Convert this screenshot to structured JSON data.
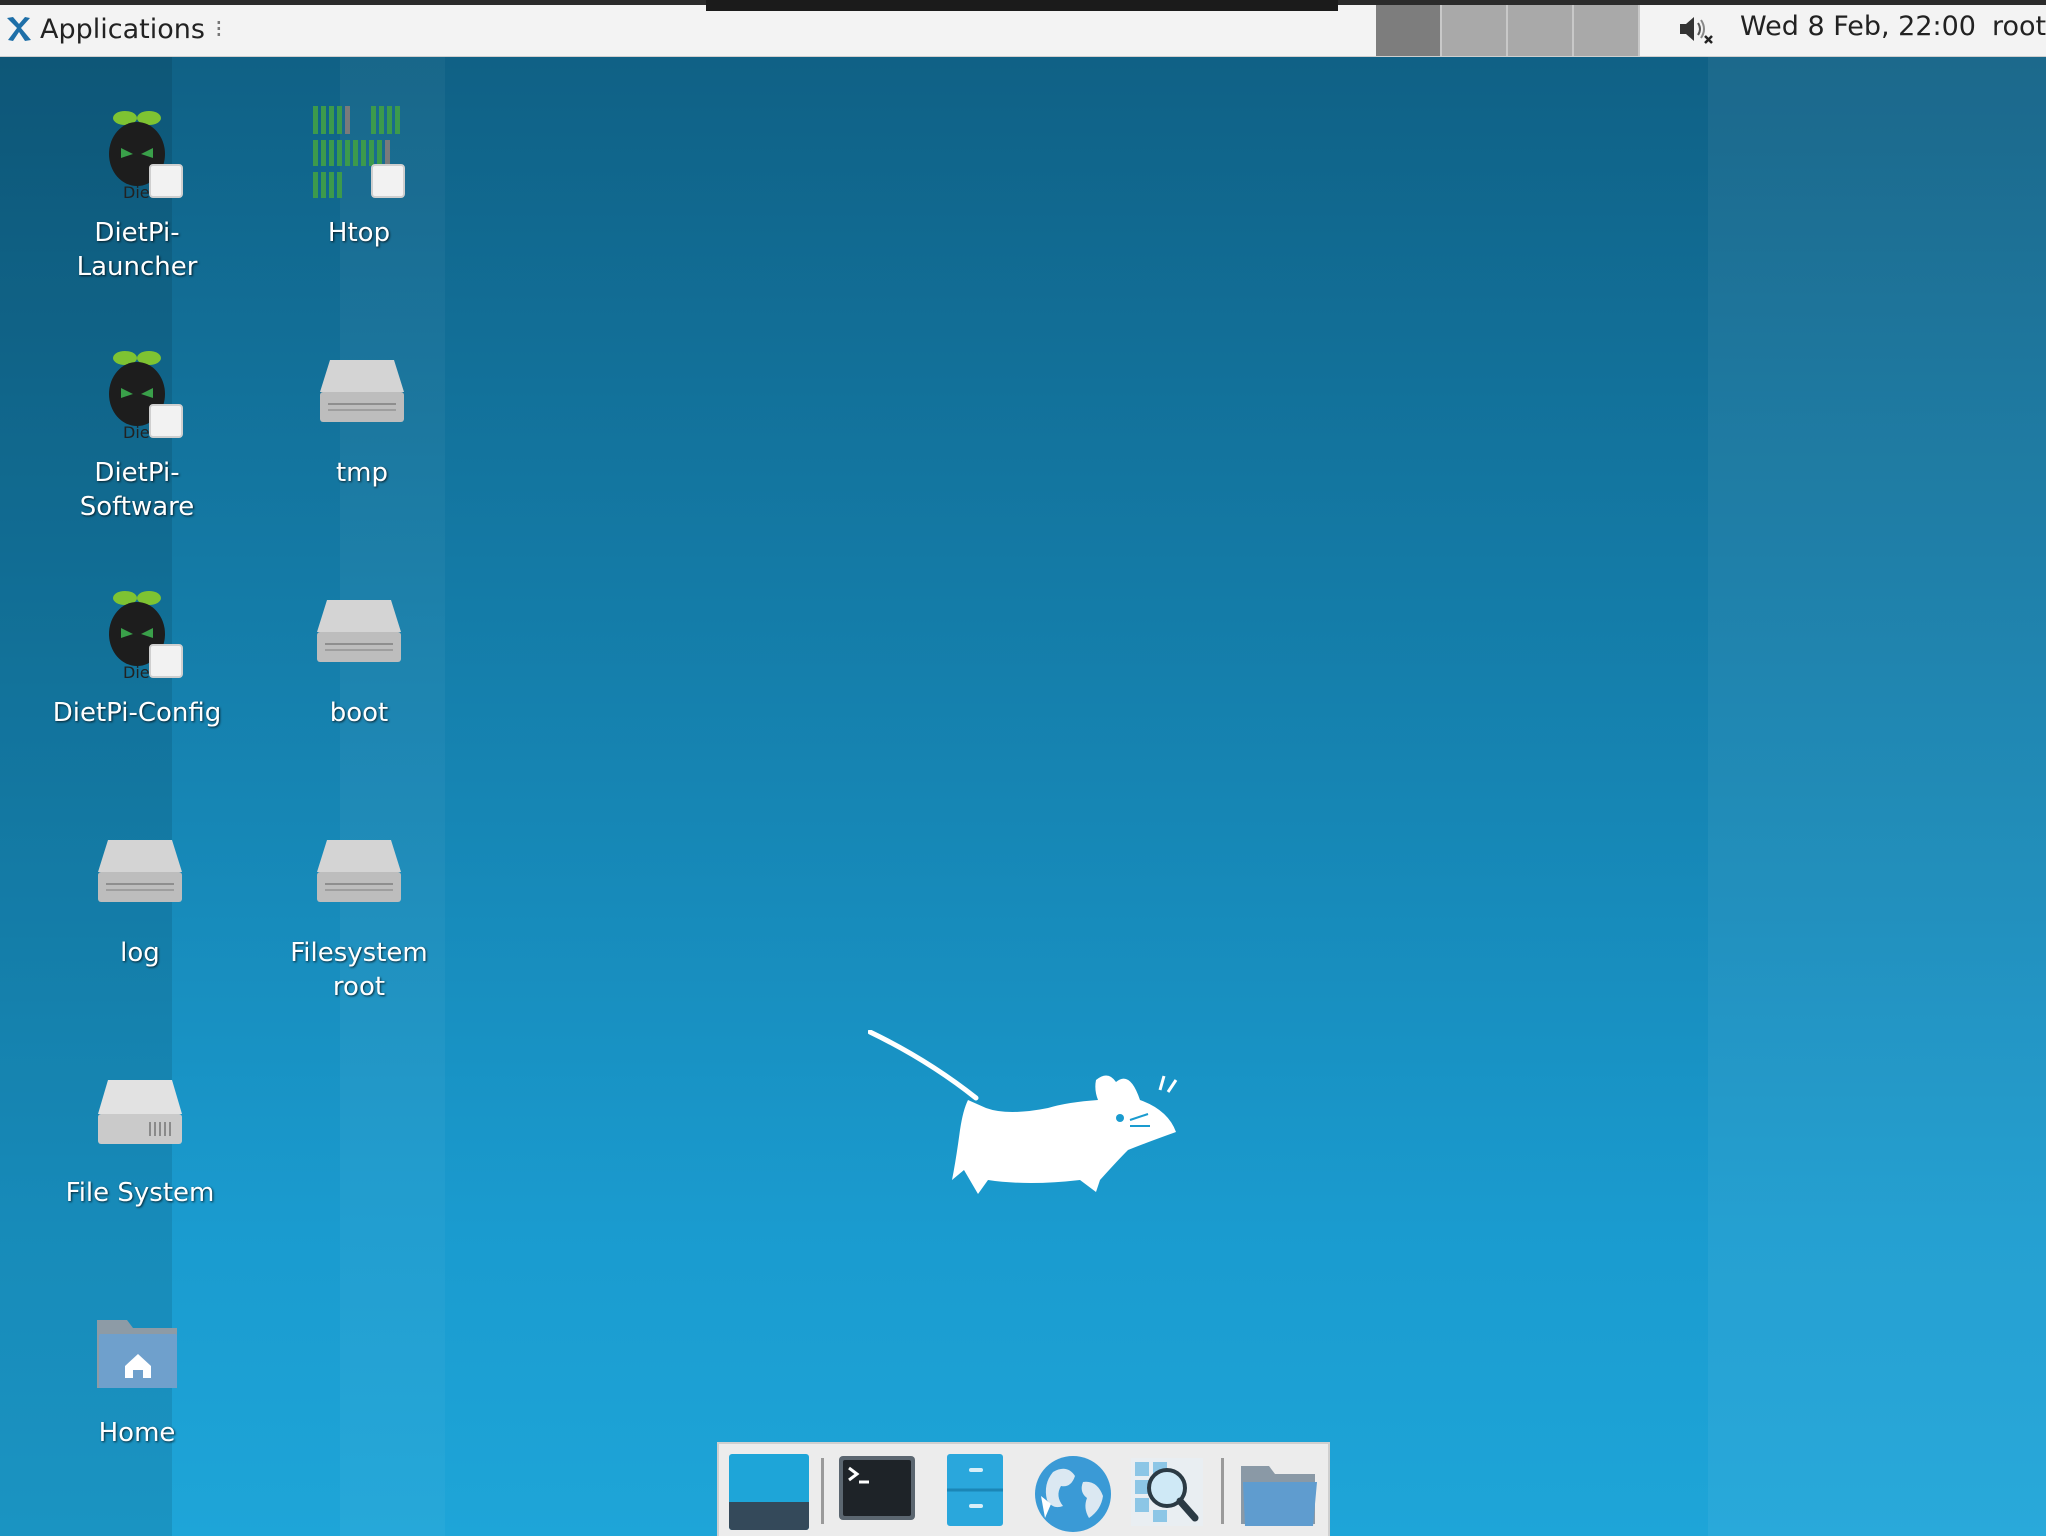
{
  "top_panel": {
    "applications_label": "Applications",
    "clock": "Wed  8 Feb, 22:00",
    "user": "root",
    "workspaces": 4,
    "active_workspace": 1
  },
  "desktop": {
    "icons": {
      "dietpi_launcher": "DietPi-\nLauncher",
      "htop": "Htop",
      "dietpi_software": "DietPi-\nSoftware",
      "tmp": "tmp",
      "dietpi_config": "DietPi-Config",
      "boot": "boot",
      "log": "log",
      "filesystem_root": "Filesystem\nroot",
      "file_system": "File System",
      "home": "Home"
    },
    "background_color": "#1a9bcf"
  },
  "dock": {
    "items": [
      "show-desktop",
      "terminal",
      "file-manager",
      "web-browser",
      "app-finder",
      "folder"
    ]
  }
}
